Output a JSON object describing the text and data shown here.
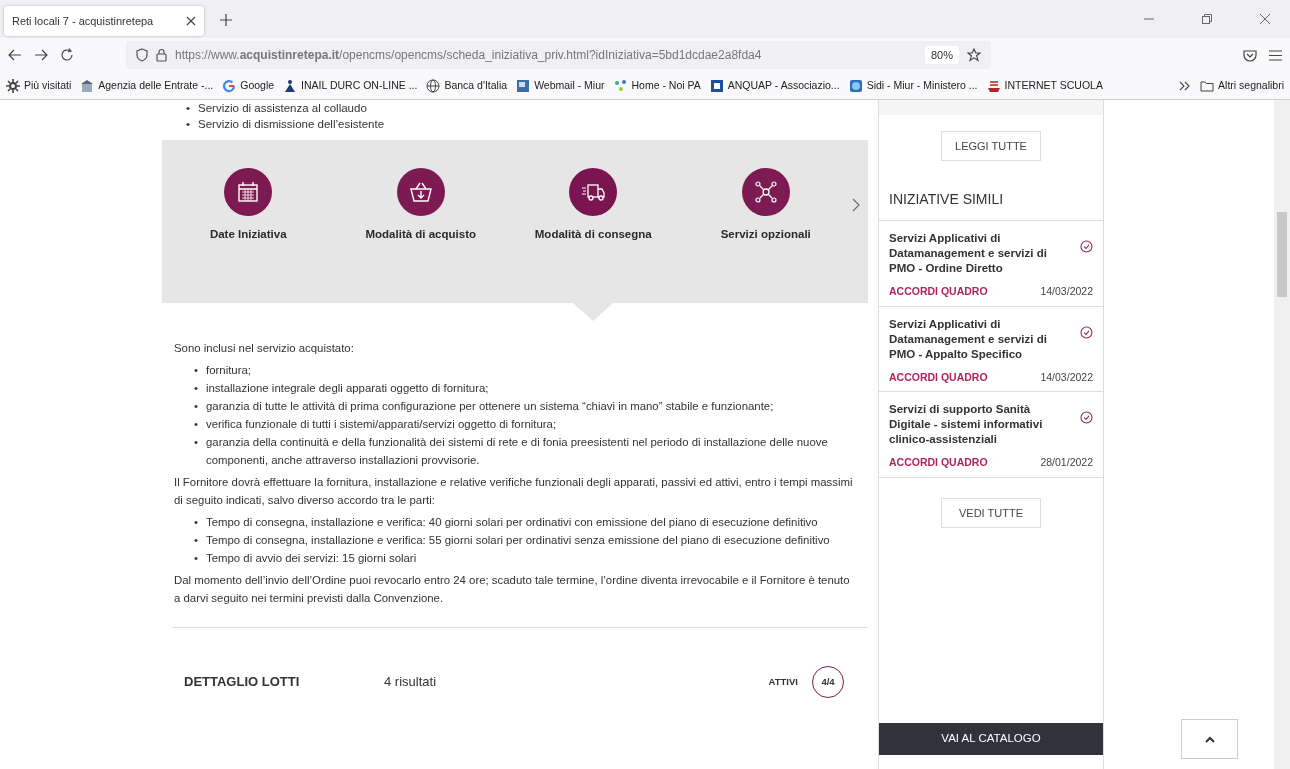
{
  "browser": {
    "tab_title": "Reti locali 7 - acquistinretepa",
    "url": "https://www.**acquistinretepa.it**/opencms/opencms/scheda_iniziativa_priv.html?idIniziativa=5bd1dcdae2a8fda4",
    "zoom": "80%",
    "bookmarks": [
      {
        "label": "Più visitati",
        "kind": "gear"
      },
      {
        "label": "Agenzia delle Entrate -...",
        "kind": "agency"
      },
      {
        "label": "Google",
        "kind": "google"
      },
      {
        "label": "INAIL DURC ON-LINE ...",
        "kind": "inail"
      },
      {
        "label": "Banca d'Italia",
        "kind": "globe"
      },
      {
        "label": "Webmail - Miur",
        "kind": "mail"
      },
      {
        "label": "Home - Noi PA",
        "kind": "noipa"
      },
      {
        "label": "ANQUAP - Associazio...",
        "kind": "anquap"
      },
      {
        "label": "Sidi - Miur - Ministero ...",
        "kind": "sidi"
      },
      {
        "label": "INTERNET SCUOLA",
        "kind": "school"
      }
    ],
    "other_bookmarks": "Altri segnalibri"
  },
  "bullet": "•",
  "top_bullets": [
    "Servizio di assistenza al collaudo",
    "Servizio di dismissione dell’esistente"
  ],
  "feature_tabs": [
    {
      "label": "Date Iniziativa",
      "kind": "calendar",
      "selected": false
    },
    {
      "label": "Modalità di acquisto",
      "kind": "basket",
      "selected": false
    },
    {
      "label": "Modalità di consegna",
      "kind": "truck",
      "selected": true
    },
    {
      "label": "Servizi opzionali",
      "kind": "network",
      "selected": false
    }
  ],
  "content": [
    {
      "kind": "paragraph",
      "text": "Sono inclusi nel servizio acquistato:"
    },
    {
      "kind": "list",
      "items": [
        "fornitura;",
        "installazione integrale degli apparati oggetto di fornitura;",
        "garanzia di tutte le attività di prima configurazione per ottenere un sistema “chiavi in mano” stabile e funzionante;",
        "verifica funzionale di tutti i sistemi/apparati/servizi oggetto di fornitura;",
        "garanzia della continuità e della funzionalità dei sistemi di rete e di fonia preesistenti nel periodo di installazione delle nuove componenti, anche attraverso installazioni provvisorie."
      ]
    },
    {
      "kind": "paragraph",
      "text": "Il Fornitore dovrà effettuare la fornitura, installazione e relative verifiche funzionali degli apparati, passivi ed attivi, entro i tempi massimi di seguito indicati, salvo diverso accordo tra le parti:"
    },
    {
      "kind": "list",
      "items": [
        "Tempo di consegna, installazione e verifica: 40 giorni solari per ordinativi con emissione del piano di esecuzione definitivo",
        "Tempo di consegna, installazione e verifica: 55 giorni solari per ordinativi senza emissione del piano di esecuzione definitivo",
        "Tempo di avvio dei servizi: 15 giorni solari"
      ]
    },
    {
      "kind": "paragraph",
      "text": "Dal momento dell’invio dell’Ordine puoi revocarlo entro 24 ore; scaduto tale termine, l’ordine diventa irrevocabile e il Fornitore è tenuto a darvi seguito nei termini previsti dalla Convenzione."
    }
  ],
  "lotti": {
    "title": "DETTAGLIO LOTTI",
    "count": "4 risultati",
    "filter_label": "ATTIVI",
    "filter_count": "4/4"
  },
  "sidebar": {
    "read_all_button": "LEGGI TUTTE",
    "similar_title": "INIZIATIVE SIMILI",
    "similar": [
      {
        "title": "Servizi Applicativi di Datamanagement e servizi di PMO - Ordine Diretto",
        "category": "ACCORDI QUADRO",
        "date": "14/03/2022"
      },
      {
        "title": "Servizi Applicativi di Datamanagement e servizi di PMO - Appalto Specifico",
        "category": "ACCORDI QUADRO",
        "date": "14/03/2022"
      },
      {
        "title": "Servizi di supporto Sanità Digitale - sistemi informativi clinico-assistenziali",
        "category": "ACCORDI QUADRO",
        "date": "28/01/2022"
      }
    ],
    "see_all_button": "VEDI TUTTE",
    "catalog_button": "VAI AL CATALOGO"
  }
}
